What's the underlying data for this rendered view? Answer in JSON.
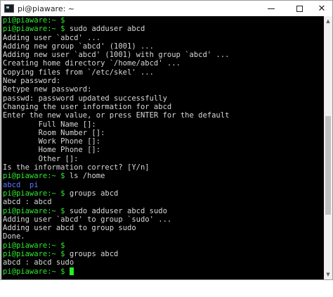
{
  "window": {
    "title": "pi@piaware: ~",
    "icon": "terminal-icon"
  },
  "controls": {
    "minimize_icon": "minimize-icon",
    "maximize_icon": "maximize-icon",
    "close_icon": "close-icon",
    "close_glyph": "✕"
  },
  "terminal": {
    "lines": [
      {
        "prompt": "pi@piaware:~ $",
        "text": ""
      },
      {
        "prompt": "pi@piaware:~ $",
        "text": " sudo adduser abcd"
      },
      {
        "prompt": "",
        "text": "Adding user `abcd' ..."
      },
      {
        "prompt": "",
        "text": "Adding new group `abcd' (1001) ..."
      },
      {
        "prompt": "",
        "text": "Adding new user `abcd' (1001) with group `abcd' ..."
      },
      {
        "prompt": "",
        "text": "Creating home directory `/home/abcd' ..."
      },
      {
        "prompt": "",
        "text": "Copying files from `/etc/skel' ..."
      },
      {
        "prompt": "",
        "text": "New password:"
      },
      {
        "prompt": "",
        "text": "Retype new password:"
      },
      {
        "prompt": "",
        "text": "passwd: password updated successfully"
      },
      {
        "prompt": "",
        "text": "Changing the user information for abcd"
      },
      {
        "prompt": "",
        "text": "Enter the new value, or press ENTER for the default"
      },
      {
        "prompt": "",
        "text": "        Full Name []:"
      },
      {
        "prompt": "",
        "text": "        Room Number []:"
      },
      {
        "prompt": "",
        "text": "        Work Phone []:"
      },
      {
        "prompt": "",
        "text": "        Home Phone []:"
      },
      {
        "prompt": "",
        "text": "        Other []:"
      },
      {
        "prompt": "",
        "text": "Is the information correct? [Y/n]"
      },
      {
        "prompt": "pi@piaware:~ $",
        "text": " ls /home"
      },
      {
        "prompt": "",
        "text": "abcd  pi",
        "color": "blue"
      },
      {
        "prompt": "pi@piaware:~ $",
        "text": " groups abcd"
      },
      {
        "prompt": "",
        "text": "abcd : abcd"
      },
      {
        "prompt": "pi@piaware:~ $",
        "text": " sudo adduser abcd sudo"
      },
      {
        "prompt": "",
        "text": "Adding user `abcd' to group `sudo' ..."
      },
      {
        "prompt": "",
        "text": "Adding user abcd to group sudo"
      },
      {
        "prompt": "",
        "text": "Done."
      },
      {
        "prompt": "pi@piaware:~ $",
        "text": ""
      },
      {
        "prompt": "pi@piaware:~ $",
        "text": " groups abcd"
      },
      {
        "prompt": "",
        "text": "abcd : abcd sudo"
      },
      {
        "prompt": "pi@piaware:~ $",
        "text": " ",
        "cursor": true
      }
    ]
  },
  "scrollbar": {
    "up_glyph": "▲",
    "down_glyph": "▼",
    "position_fraction": 0.62
  },
  "colors": {
    "background": "#000000",
    "text": "#d8d8d8",
    "prompt": "#2ee62e",
    "directory": "#5a76ff",
    "cursor": "#22ee22"
  }
}
